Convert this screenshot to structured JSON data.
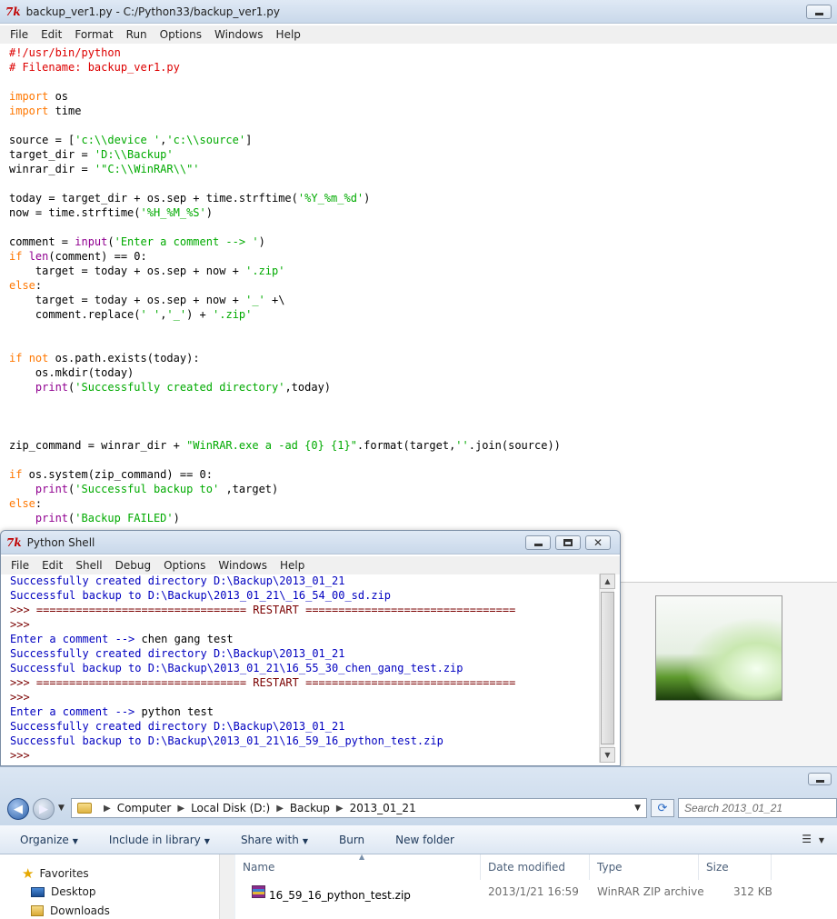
{
  "editor": {
    "title": "backup_ver1.py - C:/Python33/backup_ver1.py",
    "menu": [
      "File",
      "Edit",
      "Format",
      "Run",
      "Options",
      "Windows",
      "Help"
    ]
  },
  "code_lines": [
    [
      {
        "t": "#!/usr/bin/python",
        "c": "cm"
      }
    ],
    [
      {
        "t": "# Filename: backup_ver1.py",
        "c": "cm"
      }
    ],
    [],
    [
      {
        "t": "import",
        "c": "kw"
      },
      {
        "t": " os"
      }
    ],
    [
      {
        "t": "import",
        "c": "kw"
      },
      {
        "t": " time"
      }
    ],
    [],
    [
      {
        "t": "source = ["
      },
      {
        "t": "'c:\\\\device '",
        "c": "st"
      },
      {
        "t": ","
      },
      {
        "t": "'c:\\\\source'",
        "c": "st"
      },
      {
        "t": "]"
      }
    ],
    [
      {
        "t": "target_dir = "
      },
      {
        "t": "'D:\\\\Backup'",
        "c": "st"
      }
    ],
    [
      {
        "t": "winrar_dir = "
      },
      {
        "t": "'\"C:\\\\WinRAR\\\\\"'",
        "c": "st"
      }
    ],
    [],
    [
      {
        "t": "today = target_dir + os.sep + time.strftime("
      },
      {
        "t": "'%Y_%m_%d'",
        "c": "st"
      },
      {
        "t": ")"
      }
    ],
    [
      {
        "t": "now = time.strftime("
      },
      {
        "t": "'%H_%M_%S'",
        "c": "st"
      },
      {
        "t": ")"
      }
    ],
    [],
    [
      {
        "t": "comment = "
      },
      {
        "t": "input",
        "c": "bi"
      },
      {
        "t": "("
      },
      {
        "t": "'Enter a comment --> '",
        "c": "st"
      },
      {
        "t": ")"
      }
    ],
    [
      {
        "t": "if",
        "c": "kw"
      },
      {
        "t": " "
      },
      {
        "t": "len",
        "c": "bi"
      },
      {
        "t": "(comment) == 0:"
      }
    ],
    [
      {
        "t": "    target = today + os.sep + now + "
      },
      {
        "t": "'.zip'",
        "c": "st"
      }
    ],
    [
      {
        "t": "else",
        "c": "kw"
      },
      {
        "t": ":"
      }
    ],
    [
      {
        "t": "    target = today + os.sep + now + "
      },
      {
        "t": "'_'",
        "c": "st"
      },
      {
        "t": " +\\"
      }
    ],
    [
      {
        "t": "    comment.replace("
      },
      {
        "t": "' '",
        "c": "st"
      },
      {
        "t": ","
      },
      {
        "t": "'_'",
        "c": "st"
      },
      {
        "t": ") + "
      },
      {
        "t": "'.zip'",
        "c": "st"
      }
    ],
    [],
    [],
    [
      {
        "t": "if",
        "c": "kw"
      },
      {
        "t": " "
      },
      {
        "t": "not",
        "c": "kw"
      },
      {
        "t": " os.path.exists(today):"
      }
    ],
    [
      {
        "t": "    os.mkdir(today)"
      }
    ],
    [
      {
        "t": "    "
      },
      {
        "t": "print",
        "c": "bi"
      },
      {
        "t": "("
      },
      {
        "t": "'Successfully created directory'",
        "c": "st"
      },
      {
        "t": ",today)"
      }
    ],
    [],
    [],
    [],
    [
      {
        "t": "zip_command = winrar_dir + "
      },
      {
        "t": "\"WinRAR.exe a -ad {0} {1}\"",
        "c": "st"
      },
      {
        "t": ".format(target,"
      },
      {
        "t": "''",
        "c": "st"
      },
      {
        "t": ".join(source))"
      }
    ],
    [],
    [
      {
        "t": "if",
        "c": "kw"
      },
      {
        "t": " os.system(zip_command) == 0:"
      }
    ],
    [
      {
        "t": "    "
      },
      {
        "t": "print",
        "c": "bi"
      },
      {
        "t": "("
      },
      {
        "t": "'Successful backup to'",
        "c": "st"
      },
      {
        "t": " ,target)"
      }
    ],
    [
      {
        "t": "else",
        "c": "kw"
      },
      {
        "t": ":"
      }
    ],
    [
      {
        "t": "    "
      },
      {
        "t": "print",
        "c": "bi"
      },
      {
        "t": "("
      },
      {
        "t": "'Backup FAILED'",
        "c": "st"
      },
      {
        "t": ")"
      }
    ]
  ],
  "shell": {
    "title": "Python Shell",
    "menu": [
      "File",
      "Edit",
      "Shell",
      "Debug",
      "Options",
      "Windows",
      "Help"
    ],
    "lines": [
      {
        "t": "Successfully created directory D:\\Backup\\2013_01_21",
        "k": "out"
      },
      {
        "t": "Successful backup to D:\\Backup\\2013_01_21\\_16_54_00_sd.zip",
        "k": "out"
      },
      {
        "t": ">>> ================================ RESTART ================================",
        "k": "prompt"
      },
      {
        "t": ">>>",
        "k": "prompt"
      },
      {
        "p": "Enter a comment --> ",
        "t": "chen gang test",
        "k": "input"
      },
      {
        "t": "Successfully created directory D:\\Backup\\2013_01_21",
        "k": "out"
      },
      {
        "t": "Successful backup to D:\\Backup\\2013_01_21\\16_55_30_chen_gang_test.zip",
        "k": "out"
      },
      {
        "t": ">>> ================================ RESTART ================================",
        "k": "prompt"
      },
      {
        "t": ">>>",
        "k": "prompt"
      },
      {
        "p": "Enter a comment --> ",
        "t": "python test",
        "k": "input"
      },
      {
        "t": "Successfully created directory D:\\Backup\\2013_01_21",
        "k": "out"
      },
      {
        "t": "Successful backup to D:\\Backup\\2013_01_21\\16_59_16_python_test.zip",
        "k": "out"
      },
      {
        "t": ">>>",
        "k": "prompt"
      }
    ]
  },
  "explorer": {
    "breadcrumb": [
      "Computer",
      "Local Disk (D:)",
      "Backup",
      "2013_01_21"
    ],
    "search_placeholder": "Search 2013_01_21",
    "commands": [
      "Organize",
      "Include in library",
      "Share with",
      "Burn",
      "New folder"
    ],
    "nav": [
      "Favorites",
      "Desktop",
      "Downloads"
    ],
    "columns": [
      "Name",
      "Date modified",
      "Type",
      "Size"
    ],
    "files": [
      {
        "name": "16_59_16_python_test.zip",
        "date": "2013/1/21 16:59",
        "type": "WinRAR ZIP archive",
        "size": "312 KB"
      }
    ]
  }
}
